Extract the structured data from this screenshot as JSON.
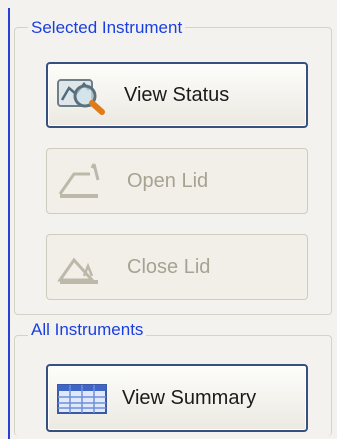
{
  "selected_instrument": {
    "legend": "Selected Instrument",
    "view_status_label": "View Status",
    "open_lid_label": "Open Lid",
    "close_lid_label": "Close Lid"
  },
  "all_instruments": {
    "legend": "All Instruments",
    "view_summary_label": "View Summary"
  },
  "icons": {
    "view_status": "magnifier-chart-icon",
    "open_lid": "open-lid-icon",
    "close_lid": "close-lid-icon",
    "view_summary": "table-grid-icon"
  },
  "colors": {
    "accent": "#1a3fe0",
    "group_border": "#d5d2c6",
    "enabled_border": "#36507f",
    "disabled_text": "#a6a393",
    "panel_bg": "#f3f2ee"
  }
}
